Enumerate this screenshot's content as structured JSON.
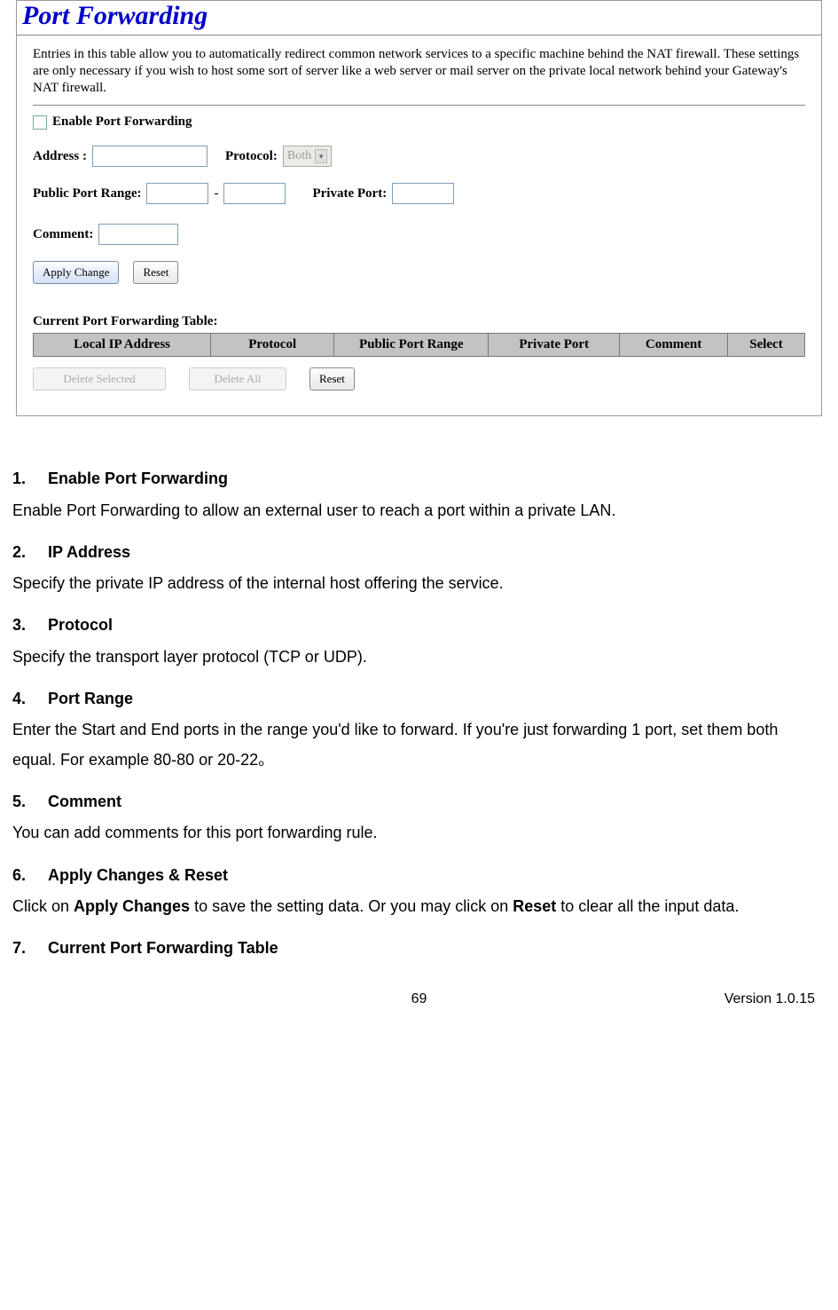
{
  "screenshot": {
    "title": "Port Forwarding",
    "intro": "Entries in this table allow you to automatically redirect common network services to a specific machine behind the NAT firewall. These settings are only necessary if you wish to host some sort of server like a web server or mail server on the private local network behind your Gateway's NAT firewall.",
    "enable_label": "Enable Port Forwarding",
    "address_label": "Address :",
    "protocol_label": "Protocol:",
    "protocol_value": "Both",
    "public_port_range_label": "Public Port Range:",
    "range_sep": "-",
    "private_port_label": "Private Port:",
    "comment_label": "Comment:",
    "apply_btn": "Apply Change",
    "reset_btn": "Reset",
    "table_caption": "Current Port Forwarding Table:",
    "table_headers": [
      "Local IP Address",
      "Protocol",
      "Public Port Range",
      "Private Port",
      "Comment",
      "Select"
    ],
    "delete_selected_btn": "Delete Selected",
    "delete_all_btn": "Delete All",
    "reset2_btn": "Reset"
  },
  "doc": {
    "items": [
      {
        "num": "1.",
        "title": "Enable Port Forwarding",
        "body": "Enable Port Forwarding to allow an external user to reach a port within a private LAN."
      },
      {
        "num": "2.",
        "title": "IP Address",
        "body": "Specify the private IP address of the internal host offering the service."
      },
      {
        "num": "3.",
        "title": "Protocol",
        "body": "Specify the transport layer protocol (TCP or UDP)."
      },
      {
        "num": "4.",
        "title": "Port Range",
        "body": "Enter the Start and End ports in the range you'd like to forward. If you're just forwarding 1 port, set them both equal. For example 80-80 or 20-22。"
      },
      {
        "num": "5.",
        "title": "Comment",
        "body": "You can add comments for this port forwarding rule."
      },
      {
        "num": "6.",
        "title": "Apply Changes & Reset",
        "body_pre": "Click on ",
        "bold1": "Apply Changes",
        "body_mid": " to save the setting data. Or you may click on ",
        "bold2": "Reset",
        "body_post": " to clear all the input data."
      },
      {
        "num": "7.",
        "title": "Current Port Forwarding Table"
      }
    ]
  },
  "footer": {
    "page": "69",
    "version": "Version 1.0.15"
  }
}
